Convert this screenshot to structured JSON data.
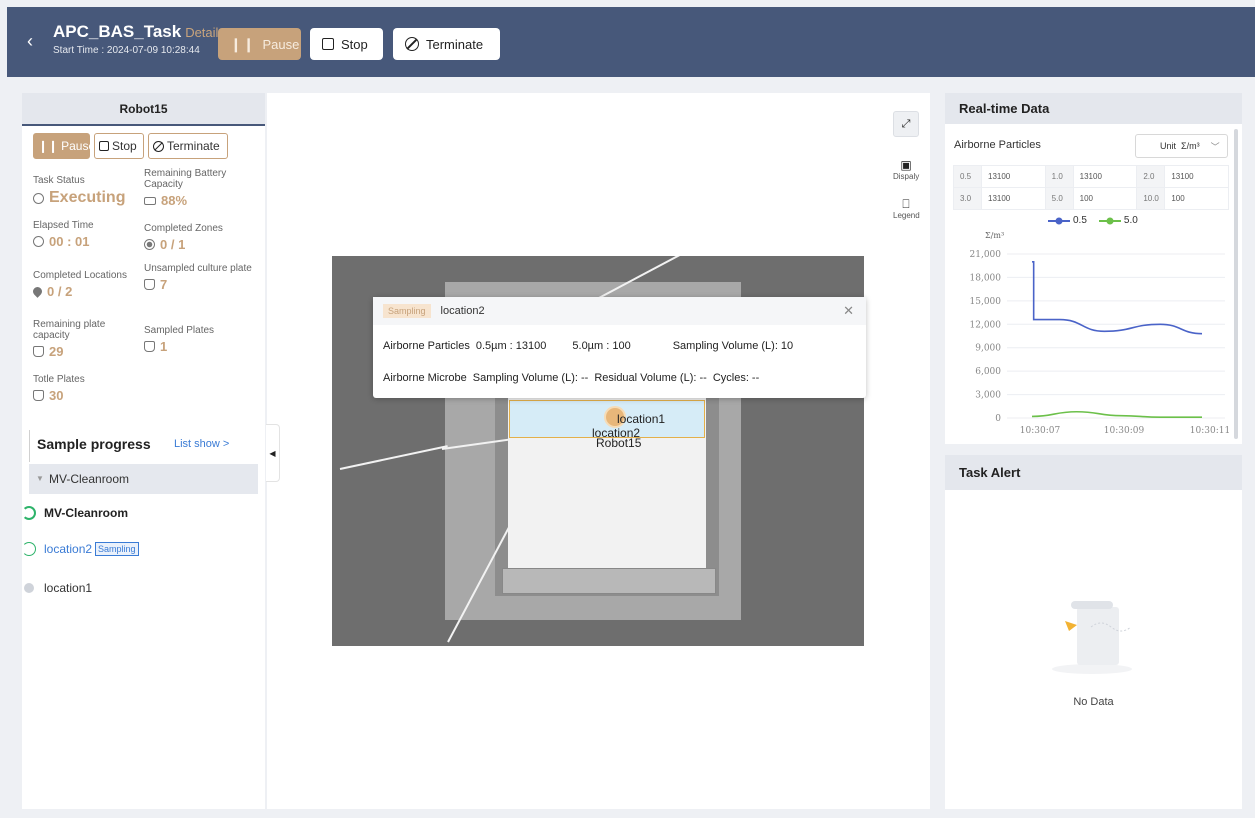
{
  "header": {
    "back_icon": "chevron-left-icon",
    "title": "APC_BAS_Task",
    "detail": "Detail",
    "start_time": "Start Time : 2024-07-09 10:28:44",
    "pause_label": "Pause",
    "stop_label": "Stop",
    "terminate_label": "Terminate"
  },
  "robot_panel": {
    "tab": "Robot15",
    "pause_label": "Pause",
    "stop_label": "Stop",
    "terminate_label": "Terminate",
    "stats": {
      "task_status": {
        "label": "Task Status",
        "value": "Executing"
      },
      "battery": {
        "label": "Remaining Battery Capacity",
        "value": "88%"
      },
      "elapsed": {
        "label": "Elapsed Time",
        "value": "00 : 01"
      },
      "zones": {
        "label": "Completed Zones",
        "value": "0 / 1"
      },
      "locations": {
        "label": "Completed Locations",
        "value": "0 / 2"
      },
      "unsampled": {
        "label": "Unsampled culture plate",
        "value": "7"
      },
      "plate_capacity": {
        "label": "Remaining plate capacity",
        "value": "29"
      },
      "sampled": {
        "label": "Sampled Plates",
        "value": "1"
      },
      "total": {
        "label": "Totle Plates",
        "value": "30"
      }
    }
  },
  "sample_progress": {
    "title": "Sample progress",
    "list_show": "List show >",
    "zone": "MV-Cleanroom",
    "items": [
      {
        "label": "MV-Cleanroom",
        "tag": ""
      },
      {
        "label": "location2",
        "tag": "Sampling"
      },
      {
        "label": "location1",
        "tag": ""
      }
    ]
  },
  "map": {
    "labels": {
      "location1": "location1",
      "location2": "location2",
      "robot": "Robot15"
    },
    "tools": {
      "display": "Dispaly",
      "legend": "Legend"
    }
  },
  "popup": {
    "tag": "Sampling",
    "location": "location2",
    "row1": {
      "a": "Airborne Particles",
      "b": "0.5µm : 13100",
      "c": "5.0µm : 100",
      "d": "Sampling Volume (L): 10"
    },
    "row2": {
      "a": "Airborne Microbe",
      "b": "Sampling Volume (L): --",
      "c": "Residual Volume (L): --",
      "d": "Cycles: --"
    }
  },
  "realtime": {
    "title": "Real-time Data",
    "airborne": "Airborne Particles",
    "unit_label": "Unit",
    "unit_value": "Σ/m³",
    "table": [
      [
        [
          "0.5",
          "13100"
        ],
        [
          "1.0",
          "13100"
        ],
        [
          "2.0",
          "13100"
        ]
      ],
      [
        [
          "3.0",
          "13100"
        ],
        [
          "5.0",
          "100"
        ],
        [
          "10.0",
          "100"
        ]
      ]
    ]
  },
  "chart_data": {
    "type": "line",
    "ylabel": "Σ/m³",
    "ylim": [
      0,
      21000
    ],
    "yticks": [
      "21,000",
      "18,000",
      "15,000",
      "12,000",
      "9,000",
      "6,000",
      "3,000",
      "0"
    ],
    "xticks": [
      "10:30:07",
      "10:30:09",
      "10:30:11"
    ],
    "series": [
      {
        "name": "0.5",
        "color": "#4a63c8",
        "points": [
          [
            0.0,
            20000
          ],
          [
            0.03,
            20000
          ],
          [
            0.03,
            12600
          ],
          [
            0.5,
            12600
          ],
          [
            1.3,
            11100
          ],
          [
            2.3,
            12000
          ],
          [
            3.05,
            10800
          ]
        ]
      },
      {
        "name": "5.0",
        "color": "#6cc04a",
        "points": [
          [
            0.0,
            200
          ],
          [
            0.8,
            800
          ],
          [
            1.6,
            300
          ],
          [
            2.3,
            100
          ],
          [
            3.05,
            100
          ]
        ]
      }
    ],
    "x_range": [
      0,
      3.05
    ],
    "legend": "top"
  },
  "task_alert": {
    "title": "Task Alert",
    "empty": "No Data"
  }
}
